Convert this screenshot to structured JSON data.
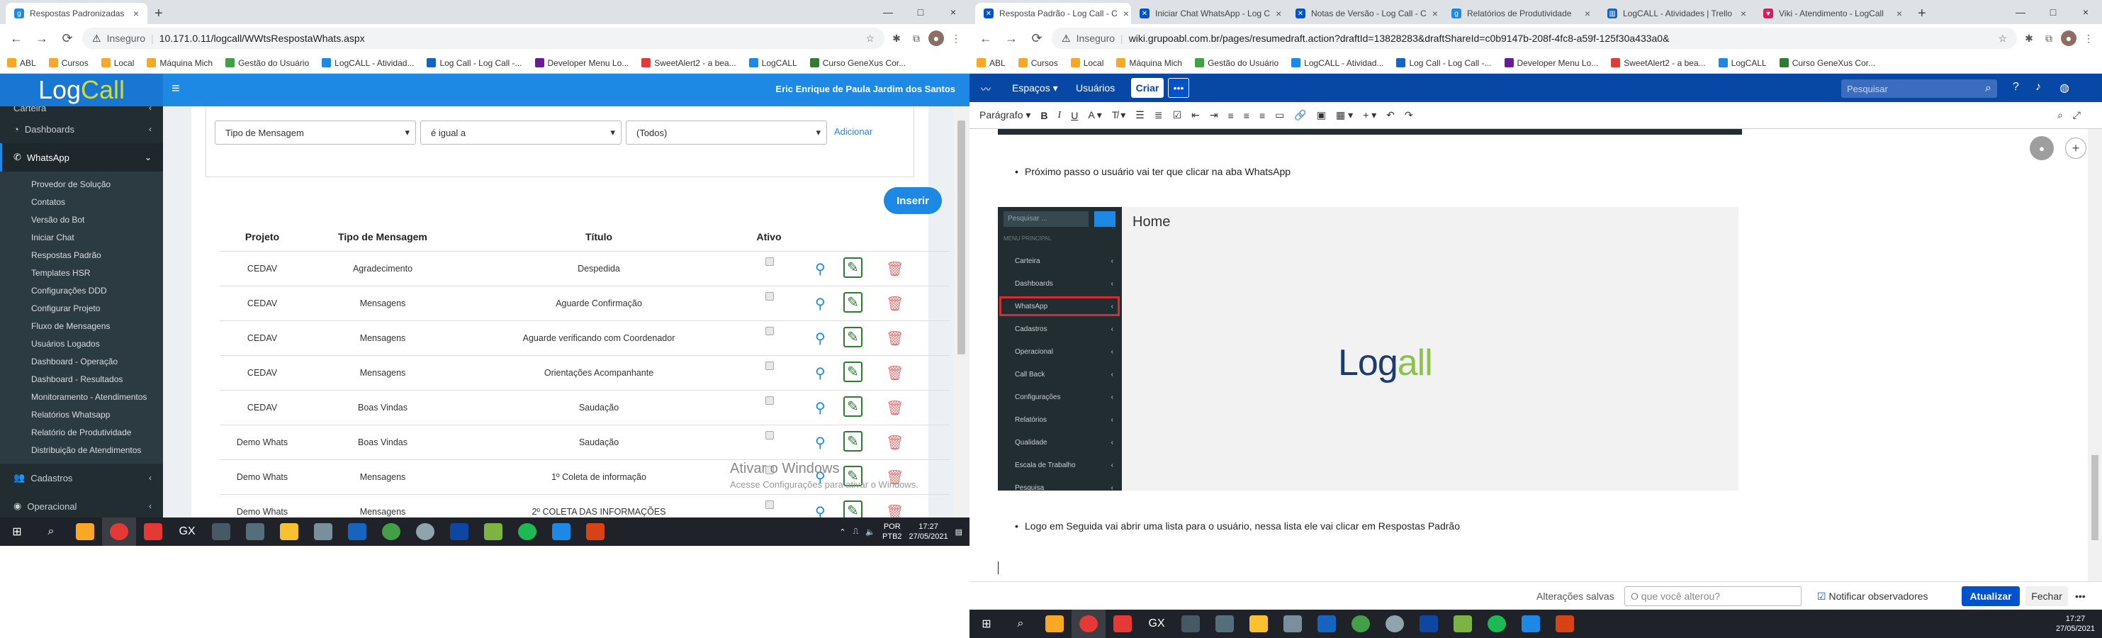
{
  "left": {
    "tabs": [
      {
        "label": "Respostas Padronizadas",
        "close": "×"
      }
    ],
    "newtab": "+",
    "win": [
      "—",
      "□",
      "×"
    ],
    "nav": [
      "←",
      "→",
      "⟳"
    ],
    "url": {
      "insecure": "Inseguro",
      "address": "10.171.0.11/logcall/WWtsRespostaWhats.aspx"
    },
    "bookmarks": [
      "ABL",
      "Cursos",
      "Local",
      "Máquina Mich",
      "Gestão do Usuário",
      "LogCALL - Atividad...",
      "Log Call - Log Call -...",
      "Developer Menu Lo...",
      "SweetAlert2 - a bea...",
      "LogCALL",
      "Curso GeneXus Cor..."
    ],
    "app": {
      "logo_a": "Log",
      "logo_b": "Call",
      "user": "Eric Enrique de Paula Jardim dos Santos",
      "menu": {
        "carteira": "Carteira",
        "dashboards": "Dashboards",
        "whatsapp": "WhatsApp",
        "sub": [
          "Provedor de Solução",
          "Contatos",
          "Versão do Bot",
          "Iniciar Chat",
          "Respostas Padrão",
          "Templates HSR",
          "Configurações DDD",
          "Configurar Projeto",
          "Fluxo de Mensagens",
          "Usuários Logados",
          "Dashboard - Operação",
          "Dashboard - Resultados",
          "Monitoramento - Atendimentos",
          "Relatórios Whatsapp",
          "Relatório de Produtividade",
          "Distribuição de Atendimentos"
        ],
        "cadastros": "Cadastros",
        "operacional": "Operacional"
      },
      "filters": {
        "field": "Tipo de Mensagem",
        "op": "é igual a",
        "value": "(Todos)",
        "add": "Adicionar"
      },
      "insert": "Inserir",
      "columns": [
        "Projeto",
        "Tipo de Mensagem",
        "Título",
        "Ativo"
      ],
      "rows": [
        [
          "CEDAV",
          "Agradecimento",
          "Despedida"
        ],
        [
          "CEDAV",
          "Mensagens",
          "Aguarde Confirmação"
        ],
        [
          "CEDAV",
          "Mensagens",
          "Aguarde verificando com Coordenador"
        ],
        [
          "CEDAV",
          "Mensagens",
          "Orientações Acompanhante"
        ],
        [
          "CEDAV",
          "Boas Vindas",
          "Saudação"
        ],
        [
          "Demo Whats",
          "Boas Vindas",
          "Saudação"
        ],
        [
          "Demo Whats",
          "Mensagens",
          "1º Coleta de informação"
        ],
        [
          "Demo Whats",
          "Mensagens",
          "2º COLETA DAS INFORMAÇÕES"
        ]
      ],
      "watermark": "Ativar o Windows",
      "watermark_sub": "Acesse Configurações para ativar o Windows."
    },
    "taskbar": {
      "lang": "POR",
      "layout": "PTB2",
      "time": "17:27",
      "date": "27/05/2021"
    }
  },
  "right": {
    "tabs": [
      {
        "label": "Resposta Padrão - Log Call - C",
        "close": "×"
      },
      {
        "label": "Iniciar Chat WhatsApp - Log C",
        "close": "×"
      },
      {
        "label": "Notas de Versão - Log Call - C",
        "close": "×"
      },
      {
        "label": "Relatórios de Produtividade",
        "close": "×"
      },
      {
        "label": "LogCALL - Atividades | Trello",
        "close": "×"
      },
      {
        "label": "Viki - Atendimento - LogCall",
        "close": "×"
      }
    ],
    "newtab": "+",
    "win": [
      "—",
      "□",
      "×"
    ],
    "nav": [
      "←",
      "→",
      "⟳"
    ],
    "url": {
      "insecure": "Inseguro",
      "address": "wiki.grupoabl.com.br/pages/resumedraft.action?draftId=13828283&draftShareId=c0b9147b-208f-4fc8-a59f-125f30a433a0&"
    },
    "bookmarks": [
      "ABL",
      "Cursos",
      "Local",
      "Máquina Mich",
      "Gestão do Usuário",
      "LogCALL - Atividad...",
      "Log Call - Log Call -...",
      "Developer Menu Lo...",
      "SweetAlert2 - a bea...",
      "LogCALL",
      "Curso GeneXus Cor..."
    ],
    "confluence": {
      "spaces": "Espaços",
      "users": "Usuários",
      "create": "Criar",
      "more": "•••",
      "search": "Pesquisar",
      "paragraph": "Parágrafo",
      "bullet1": "Próximo passo o usuário vai ter que clicar na aba WhatsApp",
      "bullet2": "Logo em Seguida vai abrir uma lista para o usuário, nessa lista ele vai clicar em Respostas Padrão",
      "shot": {
        "search": "Pesquisar ...",
        "home": "Home",
        "menu_header": "MENU PRINCIPAL",
        "items": [
          "Carteira",
          "Dashboards",
          "WhatsApp",
          "Cadastros",
          "Operacional",
          "Call Back",
          "Configurações",
          "Relatórios",
          "Qualidade",
          "Escala de Trabalho",
          "Pesquisa"
        ],
        "logo_a": "Log",
        "logo_b": "all"
      },
      "saved": "Alterações salvas",
      "change_placeholder": "O que você alterou?",
      "notify": "Notificar observadores",
      "update": "Atualizar",
      "close": "Fechar",
      "more_foot": "•••"
    },
    "taskbar": {
      "time": "17:27",
      "date": "27/05/2021"
    }
  }
}
